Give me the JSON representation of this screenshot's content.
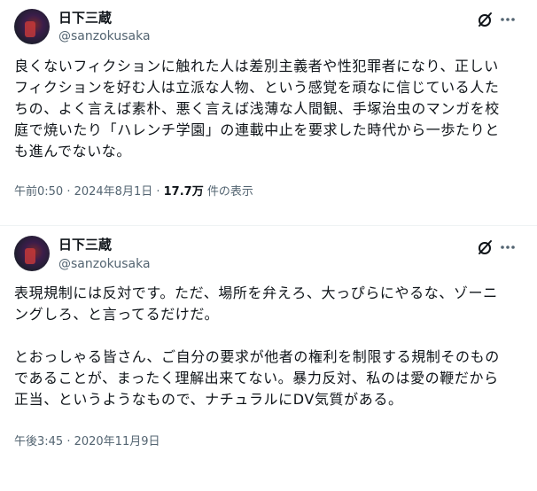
{
  "tweets": [
    {
      "author_name": "日下三蔵",
      "author_handle": "@sanzokusaka",
      "text": "良くないフィクションに触れた人は差別主義者や性犯罪者になり、正しい\nフィクションを好む人は立派な人物、という感覚を頑なに信じている人た\nちの、よく言えば素朴、悪く言えば浅薄な人間観、手塚治虫のマンガを校\n庭で焼いたり「ハレンチ学園」の連載中止を要求した時代から一歩たりと\nも進んでないな。",
      "timestamp": "午前0:50 · 2024年8月1日",
      "separator": " · ",
      "views_count": "17.7万",
      "views_label": " 件の表示"
    },
    {
      "author_name": "日下三蔵",
      "author_handle": "@sanzokusaka",
      "text": "表現規制には反対です。ただ、場所を弁えろ、大っぴらにやるな、ゾーニ\nングしろ、と言ってるだけだ。\n\nとおっしゃる皆さん、ご自分の要求が他者の権利を制限する規制そのもの\nであることが、まったく理解出来てない。暴力反対、私のは愛の鞭だから\n正当、というようなもので、ナチュラルにDV気質がある。",
      "timestamp": "午後3:45 · 2020年11月9日"
    }
  ],
  "icons": {
    "grok": "grok-slash-icon",
    "more": "more-horizontal-icon"
  },
  "colors": {
    "text": "#0f1419",
    "secondary": "#536471",
    "divider": "#eff3f4"
  }
}
